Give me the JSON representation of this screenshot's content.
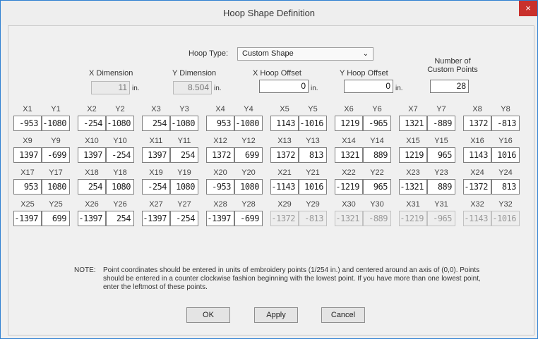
{
  "window": {
    "title": "Hoop Shape Definition",
    "close_glyph": "×"
  },
  "hoop_type": {
    "label": "Hoop Type:",
    "value": "Custom Shape",
    "options": [
      "Custom Shape"
    ]
  },
  "x_dimension": {
    "label": "X Dimension",
    "value": "11",
    "unit": "in."
  },
  "y_dimension": {
    "label": "Y Dimension",
    "value": "8.504",
    "unit": "in."
  },
  "x_offset": {
    "label": "X Hoop Offset",
    "value": "0",
    "unit": "in."
  },
  "y_offset": {
    "label": "Y Hoop Offset",
    "value": "0",
    "unit": "in."
  },
  "custom_points": {
    "label_line1": "Number of",
    "label_line2": "Custom Points",
    "value": "28"
  },
  "points": [
    {
      "x": "-953",
      "y": "-1080",
      "enabled": true
    },
    {
      "x": "-254",
      "y": "-1080",
      "enabled": true
    },
    {
      "x": "254",
      "y": "-1080",
      "enabled": true
    },
    {
      "x": "953",
      "y": "-1080",
      "enabled": true
    },
    {
      "x": "1143",
      "y": "-1016",
      "enabled": true
    },
    {
      "x": "1219",
      "y": "-965",
      "enabled": true
    },
    {
      "x": "1321",
      "y": "-889",
      "enabled": true
    },
    {
      "x": "1372",
      "y": "-813",
      "enabled": true
    },
    {
      "x": "1397",
      "y": "-699",
      "enabled": true
    },
    {
      "x": "1397",
      "y": "-254",
      "enabled": true
    },
    {
      "x": "1397",
      "y": "254",
      "enabled": true
    },
    {
      "x": "1372",
      "y": "699",
      "enabled": true
    },
    {
      "x": "1372",
      "y": "813",
      "enabled": true
    },
    {
      "x": "1321",
      "y": "889",
      "enabled": true
    },
    {
      "x": "1219",
      "y": "965",
      "enabled": true
    },
    {
      "x": "1143",
      "y": "1016",
      "enabled": true
    },
    {
      "x": "953",
      "y": "1080",
      "enabled": true
    },
    {
      "x": "254",
      "y": "1080",
      "enabled": true
    },
    {
      "x": "-254",
      "y": "1080",
      "enabled": true
    },
    {
      "x": "-953",
      "y": "1080",
      "enabled": true
    },
    {
      "x": "-1143",
      "y": "1016",
      "enabled": true
    },
    {
      "x": "-1219",
      "y": "965",
      "enabled": true
    },
    {
      "x": "-1321",
      "y": "889",
      "enabled": true
    },
    {
      "x": "-1372",
      "y": "813",
      "enabled": true
    },
    {
      "x": "-1397",
      "y": "699",
      "enabled": true
    },
    {
      "x": "-1397",
      "y": "254",
      "enabled": true
    },
    {
      "x": "-1397",
      "y": "-254",
      "enabled": true
    },
    {
      "x": "-1397",
      "y": "-699",
      "enabled": true
    },
    {
      "x": "-1372",
      "y": "-813",
      "enabled": false
    },
    {
      "x": "-1321",
      "y": "-889",
      "enabled": false
    },
    {
      "x": "-1219",
      "y": "-965",
      "enabled": false
    },
    {
      "x": "-1143",
      "y": "-1016",
      "enabled": false
    }
  ],
  "note": {
    "prefix": "NOTE:",
    "text": "Point coordinates should be entered in units of embroidery points (1/254 in.) and centered around an axis of (0,0). Points should be entered in a counter clockwise fashion beginning with the lowest point. If you have more than one lowest point, enter the leftmost of these points."
  },
  "buttons": {
    "ok": "OK",
    "apply": "Apply",
    "cancel": "Cancel"
  },
  "icons": {
    "dropdown": "chevron-down-icon",
    "close": "close-icon"
  }
}
